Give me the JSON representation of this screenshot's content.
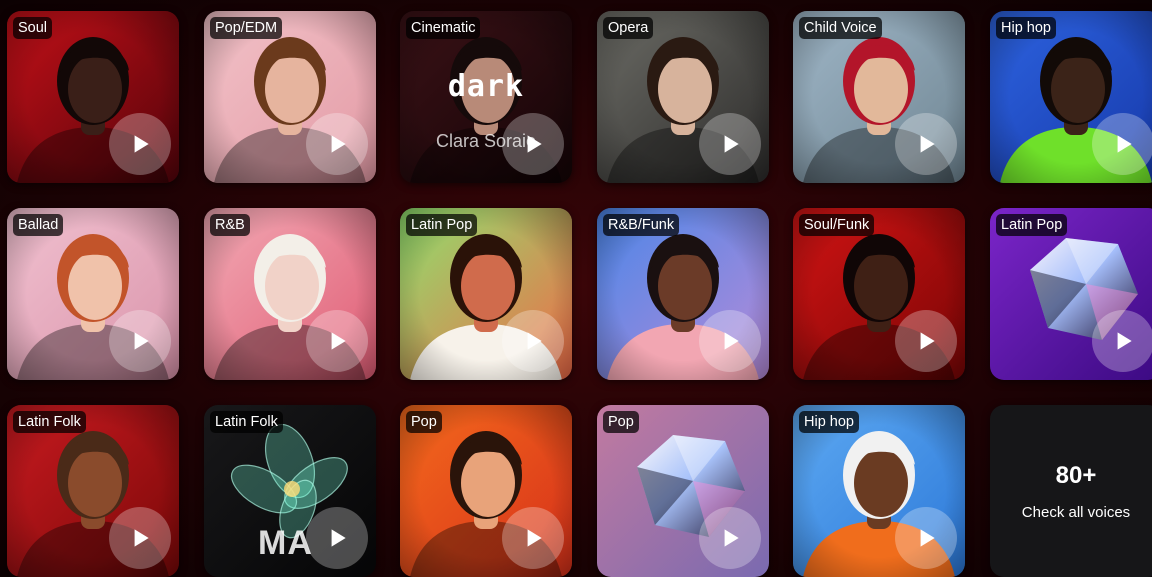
{
  "voices": [
    {
      "label": "Soul",
      "bg": [
        "#c21018",
        "#55030a"
      ],
      "skin": "#3a1f18",
      "hair": "#120807"
    },
    {
      "label": "Pop/EDM",
      "bg": [
        "#f2c2c8",
        "#e39aa5"
      ],
      "skin": "#e6b49e",
      "hair": "#6b3a1c"
    },
    {
      "label": "Cinematic",
      "bg": [
        "#3a1116",
        "#140406"
      ],
      "skin": "#b88a78",
      "hair": "#150a0a",
      "title": "dark",
      "subtitle": "Clara Soraie"
    },
    {
      "label": "Opera",
      "bg": [
        "#6c6c66",
        "#2c2b2a"
      ],
      "skin": "#d7b39c",
      "hair": "#2a1a12"
    },
    {
      "label": "Child Voice",
      "bg": [
        "#9fb6c7",
        "#6f8592"
      ],
      "skin": "#e2b89a",
      "hair": "#b3152a"
    },
    {
      "label": "Hip hop",
      "bg": [
        "#2d63e0",
        "#1638a8"
      ],
      "skin": "#3b2318",
      "hair": "#120a07",
      "shirt": "#6fe02a"
    },
    {
      "label": "Ballad",
      "bg": [
        "#f1c1d0",
        "#d993aa"
      ],
      "skin": "#f0c2aa",
      "hair": "#c2542a"
    },
    {
      "label": "R&B",
      "bg": [
        "#f2a9b4",
        "#e05d75"
      ],
      "skin": "#f1d2c8",
      "hair": "#f3efe8"
    },
    {
      "label": "Latin Pop",
      "bg": [
        "#8ee06e",
        "#f06a48"
      ],
      "skin": "#d06b4c",
      "hair": "#2a1208",
      "shirt": "#f7f2ea"
    },
    {
      "label": "R&B/Funk",
      "bg": [
        "#4b86e8",
        "#b78bd8"
      ],
      "skin": "#6b3b28",
      "hair": "#1a1010",
      "shirt": "#f2a6b2"
    },
    {
      "label": "Soul/Funk",
      "bg": [
        "#d11414",
        "#7a0505"
      ],
      "skin": "#3f2015",
      "hair": "#100606"
    },
    {
      "label": "Latin Pop",
      "bg": [
        "#7b25c9",
        "#3b0a82"
      ],
      "gem": true
    },
    {
      "label": "Latin Folk",
      "bg": [
        "#c81a20",
        "#7a0808"
      ],
      "skin": "#8a4b2c",
      "hair": "#4a2a18"
    },
    {
      "label": "Latin Folk",
      "bg": [
        "#18181a",
        "#050506"
      ],
      "flower": true,
      "logo": "MA"
    },
    {
      "label": "Pop",
      "bg": [
        "#f46a1c",
        "#d6301a"
      ],
      "skin": "#e8a37a",
      "hair": "#2a140a"
    },
    {
      "label": "Pop",
      "bg": [
        "#c27aa0",
        "#7a6ab0"
      ],
      "gem": true
    },
    {
      "label": "Hip hop",
      "bg": [
        "#5da9f2",
        "#2c78d8"
      ],
      "skin": "#6a3b22",
      "hair": "#f1f1f1",
      "shirt": "#f06d1c"
    }
  ],
  "more": {
    "count": "80+",
    "label": "Check all voices"
  }
}
